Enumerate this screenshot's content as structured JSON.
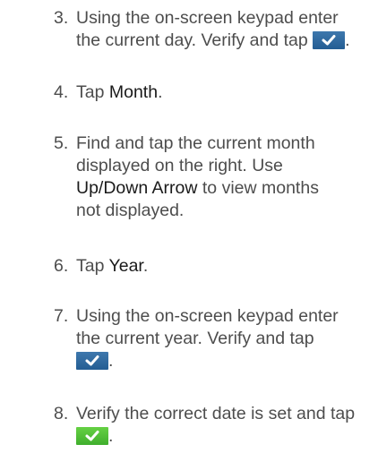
{
  "steps": [
    {
      "number": "3.",
      "line1": "Using the on-screen keypad enter",
      "line2_pre": "the current day. Verify and tap",
      "line2_post": "."
    },
    {
      "number": "4.",
      "pre": "Tap ",
      "bold": "Month",
      "post": "."
    },
    {
      "number": "5.",
      "line1": "Find and tap the current month",
      "line2": "displayed on the right. Use",
      "line3_bold": "Up/Down Arrow",
      "line3_post": " to view months",
      "line4": "not displayed."
    },
    {
      "number": "6.",
      "pre": "Tap ",
      "bold": "Year",
      "post": "."
    },
    {
      "number": "7.",
      "line1": "Using the on-screen keypad enter",
      "line2": "the current year. Verify and tap",
      "line3_post": "."
    },
    {
      "number": "8.",
      "line1": "Verify the correct date is set and tap",
      "line2_post": "."
    }
  ],
  "icons": {
    "blue_check": "check-icon",
    "green_check": "check-icon",
    "blue_color": "#2d659b",
    "green_color": "#52c23a"
  }
}
